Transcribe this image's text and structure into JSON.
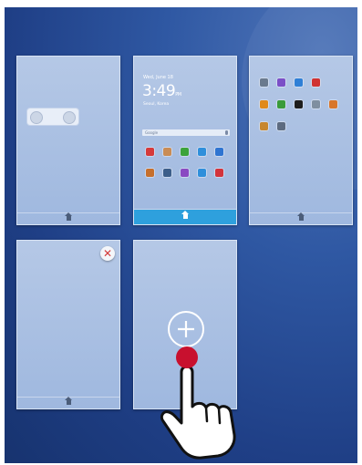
{
  "screens": [
    {
      "id": "screen-widget",
      "home_label": "home"
    },
    {
      "id": "screen-main",
      "home_label": "home",
      "clock": {
        "date": "Wed, June 18",
        "time": "3:49",
        "ampm": "PM",
        "location": "Seoul, Korea"
      },
      "search_text": "Google",
      "icons_row1": [
        "#d63a3a",
        "#c98c55",
        "#3ca33a",
        "#2f8fdb",
        "#2f74d1"
      ],
      "icons_row2": [
        "#c66f2c",
        "#3c5e8a",
        "#8a4ac2",
        "#2f8fdb",
        "#d3343c"
      ]
    },
    {
      "id": "screen-apps",
      "home_label": "home",
      "icons": [
        {
          "color": "#6a7a8e"
        },
        {
          "color": "#7b4fc7"
        },
        {
          "color": "#2f7fd6"
        },
        {
          "color": "#d03232"
        },
        {
          "color": "#e08a1c"
        },
        {
          "color": "#3a9b3a"
        },
        {
          "color": "#1d1d1d"
        },
        {
          "color": "#7f8fa0"
        },
        {
          "color": "#d8762b"
        },
        {
          "color": "#c7872f"
        },
        {
          "color": "#5d6b80"
        }
      ]
    },
    {
      "id": "screen-empty",
      "home_label": "home"
    },
    {
      "id": "screen-add",
      "home_label": "home"
    }
  ],
  "colors": {
    "accent": "#2ea0dd",
    "close": "#d43a3a",
    "touch": "#c8102e"
  }
}
